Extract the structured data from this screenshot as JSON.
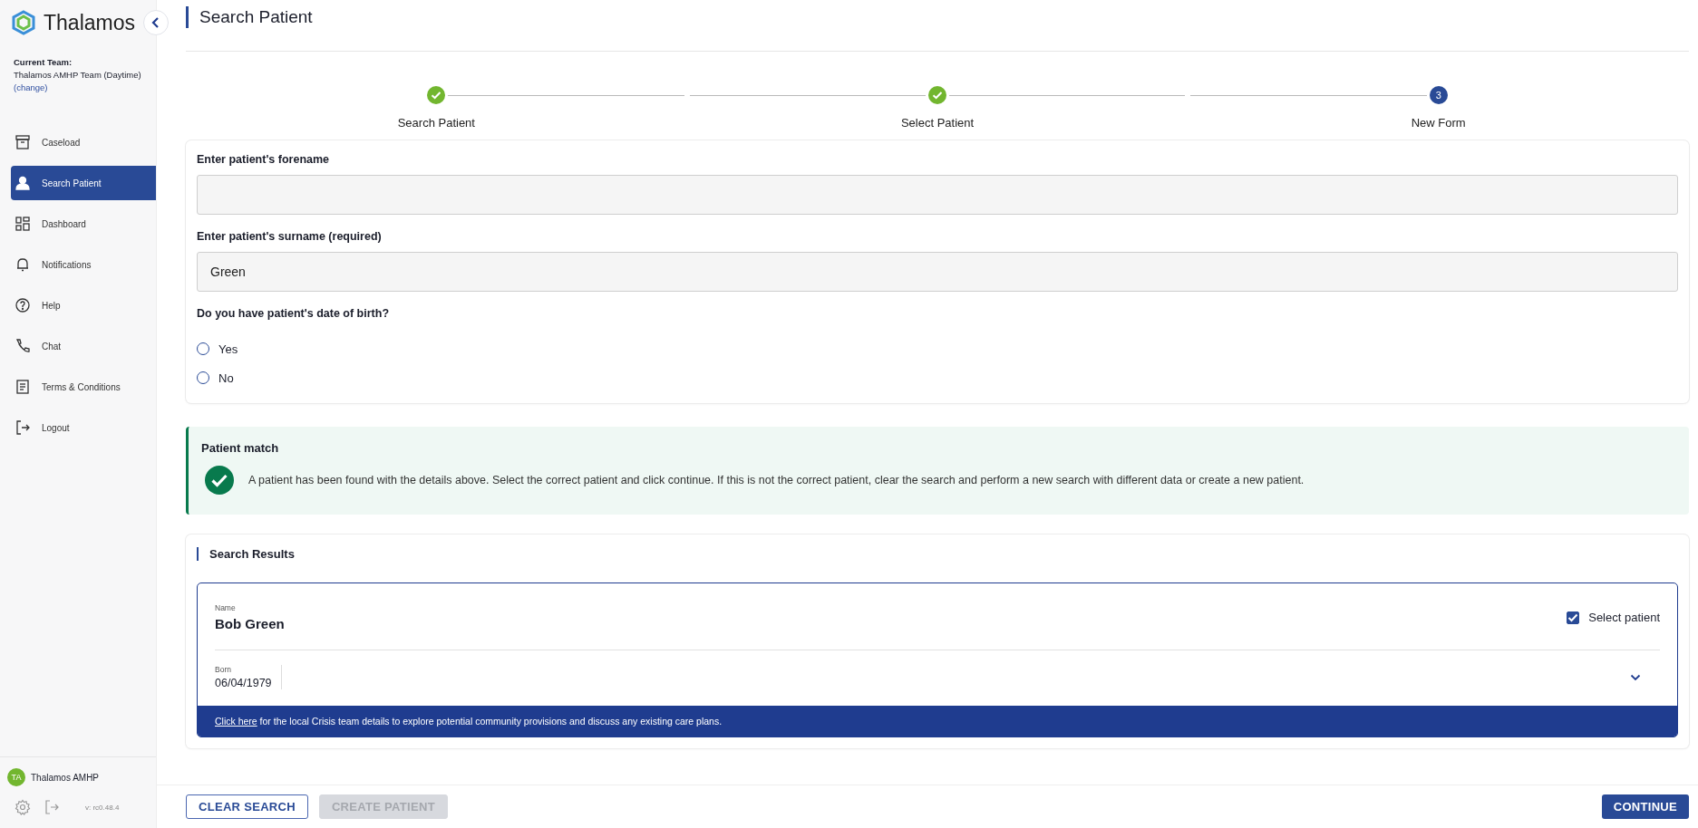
{
  "sidebar": {
    "brand": "Thalamos",
    "team_label": "Current Team:",
    "team_name": "Thalamos AMHP Team (Daytime)",
    "change_link": "(change)",
    "items": [
      {
        "label": "Caseload",
        "selected": false
      },
      {
        "label": "Search Patient",
        "selected": true
      },
      {
        "label": "Dashboard",
        "selected": false
      },
      {
        "label": "Notifications",
        "selected": false
      },
      {
        "label": "Help",
        "selected": false
      },
      {
        "label": "Chat",
        "selected": false
      },
      {
        "label": "Terms & Conditions",
        "selected": false
      },
      {
        "label": "Logout",
        "selected": false
      }
    ],
    "user": {
      "initials": "TA",
      "name": "Thalamos AMHP"
    },
    "version": "v: rc0.48.4"
  },
  "page_title": "Search Patient",
  "steps": [
    {
      "label": "Search Patient",
      "completed": true
    },
    {
      "label": "Select Patient",
      "completed": true
    },
    {
      "label": "New Form",
      "completed": false,
      "number": "3"
    }
  ],
  "form": {
    "forename": {
      "label": "Enter patient's forename"
    },
    "surname": {
      "label": "Enter patient's surname (required)",
      "value": "Green"
    },
    "dob_question": "Do you have patient's date of birth?",
    "options": [
      {
        "label": "Yes",
        "selected": false
      },
      {
        "label": "No",
        "selected": false
      }
    ]
  },
  "alert": {
    "title": "Patient match",
    "message": "A patient has been found with the details above. Select the correct patient and click continue. If this is not the correct patient, clear the search and perform a new search with different data or create a new patient."
  },
  "results": {
    "title": "Search Results",
    "patients": [
      {
        "name_label": "Name",
        "name": "Bob Green",
        "select_label": "Select patient",
        "checked": true,
        "born_label": "Born",
        "born": "06/04/1979",
        "expanded": false,
        "banner_link": "Click here",
        "banner_text": "for the local Crisis team details to explore potential community provisions and discuss any existing care plans."
      }
    ]
  },
  "footer": {
    "buttons": [
      {
        "label": "CLEAR SEARCH",
        "kind": "outline",
        "disabled": false
      },
      {
        "label": "CREATE PATIENT",
        "kind": "outline",
        "disabled": true
      },
      {
        "label": "CONTINUE",
        "kind": "primary",
        "disabled": false
      }
    ]
  }
}
